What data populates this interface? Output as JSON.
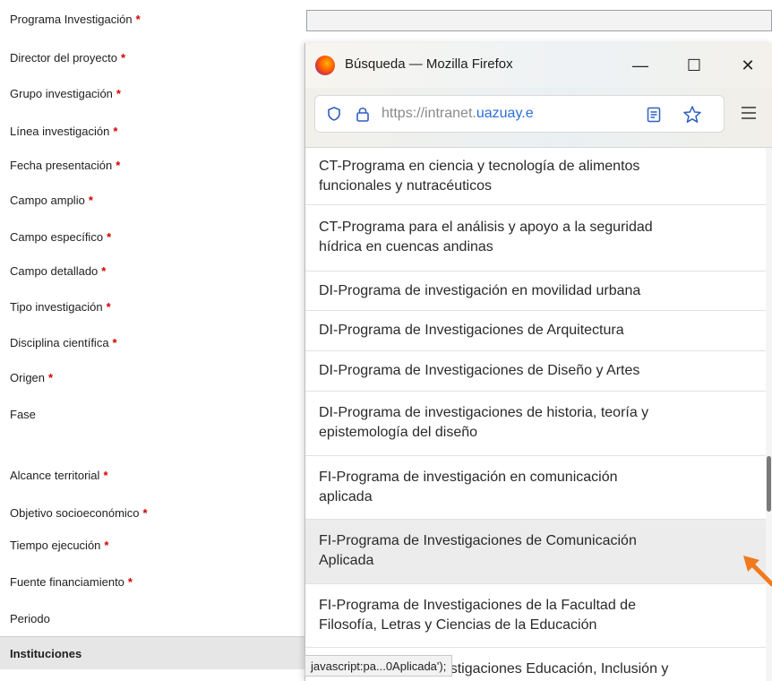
{
  "form": {
    "fields": [
      {
        "label": "Programa Investigación",
        "required": true
      },
      {
        "label": "Director del proyecto",
        "required": true
      },
      {
        "label": "Grupo investigación",
        "required": true
      },
      {
        "label": "Línea investigación",
        "required": true
      },
      {
        "label": "Fecha presentación",
        "required": true
      },
      {
        "label": "Campo amplio",
        "required": true
      },
      {
        "label": "Campo específico",
        "required": true
      },
      {
        "label": "Campo detallado",
        "required": true
      },
      {
        "label": "Tipo investigación",
        "required": true
      },
      {
        "label": "Disciplina científica",
        "required": true
      },
      {
        "label": "Origen",
        "required": true
      },
      {
        "label": "Fase",
        "required": false
      },
      {
        "label": "Alcance territorial",
        "required": true
      },
      {
        "label": "Objetivo socioeconómico",
        "required": true
      },
      {
        "label": "Tiempo ejecución",
        "required": true
      },
      {
        "label": "Fuente financiamiento",
        "required": true
      },
      {
        "label": "Periodo",
        "required": false
      }
    ],
    "required_mark": "*",
    "section": "Instituciones"
  },
  "popup": {
    "title": "Búsqueda — Mozilla Firefox",
    "controls": {
      "minimize": "—",
      "maximize": "☐",
      "close": "✕"
    },
    "url_prefix": "https://intranet.",
    "url_domain": "uazuay.e",
    "items": [
      {
        "l1": "CT-Programa en ciencia y tecnología de alimentos",
        "l2": "funcionales y nutracéuticos"
      },
      {
        "l1": "CT-Programa para el análisis y apoyo a la seguridad",
        "l2": "hídrica en cuencas andinas"
      },
      {
        "l1": "DI-Programa de investigación en movilidad urbana"
      },
      {
        "l1": "DI-Programa de Investigaciones de Arquitectura"
      },
      {
        "l1": "DI-Programa de Investigaciones de Diseño y Artes"
      },
      {
        "l1": "DI-Programa de investigaciones de historia, teoría y",
        "l2": "epistemología del diseño"
      },
      {
        "l1": "FI-Programa de investigación en comunicación",
        "l2": "aplicada"
      },
      {
        "l1": "FI-Programa de Investigaciones de Comunicación",
        "l2": "Aplicada"
      },
      {
        "l1": "FI-Programa de Investigaciones de la Facultad de",
        "l2": "Filosofía, Letras y Ciencias de la Educación"
      },
      {
        "l1": "FI-Programa de Investigaciones Educación, Inclusión y"
      }
    ],
    "highlighted_index": 7
  },
  "status_text": "javascript:pa...0Aplicada');",
  "colors": {
    "required": "#d40000",
    "url_domain": "#2f6fd6",
    "highlight": "#ececec",
    "arrow": "#f07a1e"
  }
}
